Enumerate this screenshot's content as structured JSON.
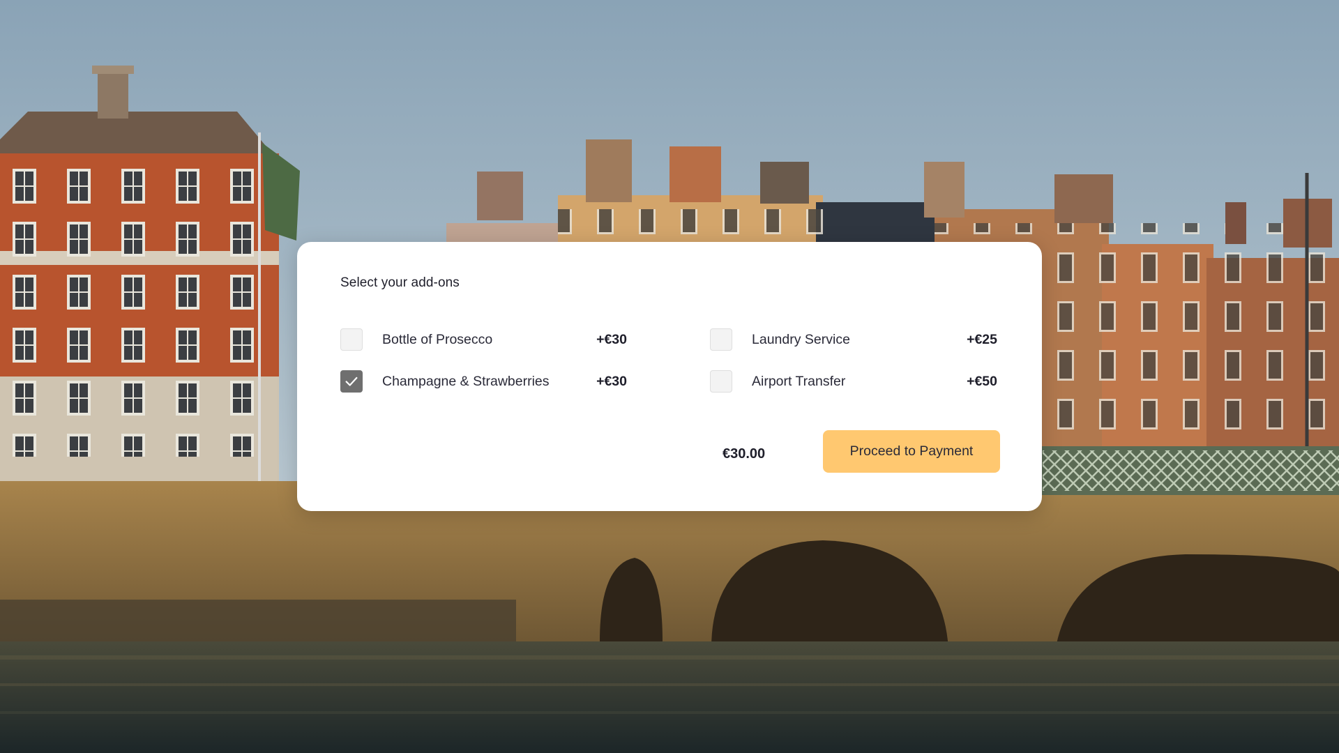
{
  "addons": {
    "title": "Select your add-ons",
    "options": [
      {
        "label": "Bottle of Prosecco",
        "price": "+€30",
        "checked": false
      },
      {
        "label": "Laundry Service",
        "price": "+€25",
        "checked": false
      },
      {
        "label": "Champagne & Strawberries",
        "price": "+€30",
        "checked": true
      },
      {
        "label": "Airport Transfer",
        "price": "+€50",
        "checked": false
      }
    ],
    "total": "€30.00",
    "proceed_label": "Proceed to Payment"
  },
  "colors": {
    "button": "#ffc870",
    "checkbox_checked": "#6f6f6f",
    "card": "#ffffff"
  },
  "icons": {
    "check": "check-icon"
  }
}
